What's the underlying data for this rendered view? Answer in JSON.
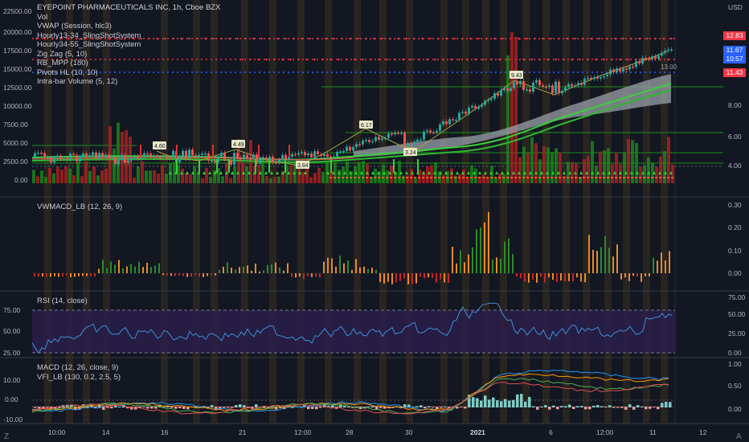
{
  "header": {
    "symbol_line": "EYEPOINT PHARMACEUTICALS INC, 1h, Cboe BZX",
    "currency": "USD"
  },
  "main_pane": {
    "indicators": [
      "Vol",
      "VWAP (Session, hlc3)",
      "Hourly13-34_SlingShotSystem",
      "Hourly34-55_SlingShotSystem",
      "Zig Zag (5, 10)",
      "RB_MPP (180)",
      "Pivots HL (10, 10)",
      "Intra-bar Volume (5, 12)"
    ],
    "left_axis": [
      "22500.00",
      "20000.00",
      "17500.00",
      "15000.00",
      "12500.00",
      "10000.00",
      "7500.00",
      "5000.00",
      "2500.00",
      "0.00"
    ],
    "right_axis": [
      "8.00",
      "6.00",
      "4.00"
    ],
    "price_badges": [
      {
        "label": "12.83",
        "color": "#f23645"
      },
      {
        "label": "11.67",
        "color": "#2962ff"
      },
      {
        "label": "10:57",
        "color": "#2962ff"
      },
      {
        "label": "11.43",
        "color": "#f23645"
      }
    ],
    "partial_label": "13.00",
    "zigzag_labels": [
      "4.60",
      "4.49",
      "6.17",
      "3.84",
      "3.24",
      "9.43"
    ]
  },
  "vwmacd_pane": {
    "title": "VWMACD_LB (12, 26, 9)",
    "right_axis": [
      "0.30",
      "0.20",
      "0.10",
      "0.00"
    ]
  },
  "rsi_pane": {
    "title": "RSI (14, close)",
    "left_axis": [
      "75.00",
      "50.00",
      "25.00"
    ],
    "right_axis": [
      "75.00",
      "50.00",
      "25.00",
      "0.00"
    ]
  },
  "macd_pane": {
    "titles": [
      "MACD (12, 26, close, 9)",
      "VFI_LB (130, 0.2, 2.5, 5)"
    ],
    "left_axis": [
      "10.00",
      "0.00",
      "-10.00"
    ],
    "right_axis": [
      "1.00",
      "0.50",
      "0.00"
    ]
  },
  "time_axis": {
    "labels": [
      "10:00",
      "14",
      "16",
      "21",
      "12:00",
      "28",
      "30",
      "2021",
      "6",
      "12:00",
      "11",
      "12"
    ]
  },
  "footer": {
    "left_icon": "Z",
    "right_icon": "A"
  },
  "colors": {
    "background": "#131722",
    "up": "#26a69a",
    "down": "#ef5350",
    "volume_up": "#1b8a1b",
    "volume_down": "#b22222",
    "resistance": "#f23645",
    "support": "#2962ff",
    "macd_orange": "#e8892b"
  }
}
